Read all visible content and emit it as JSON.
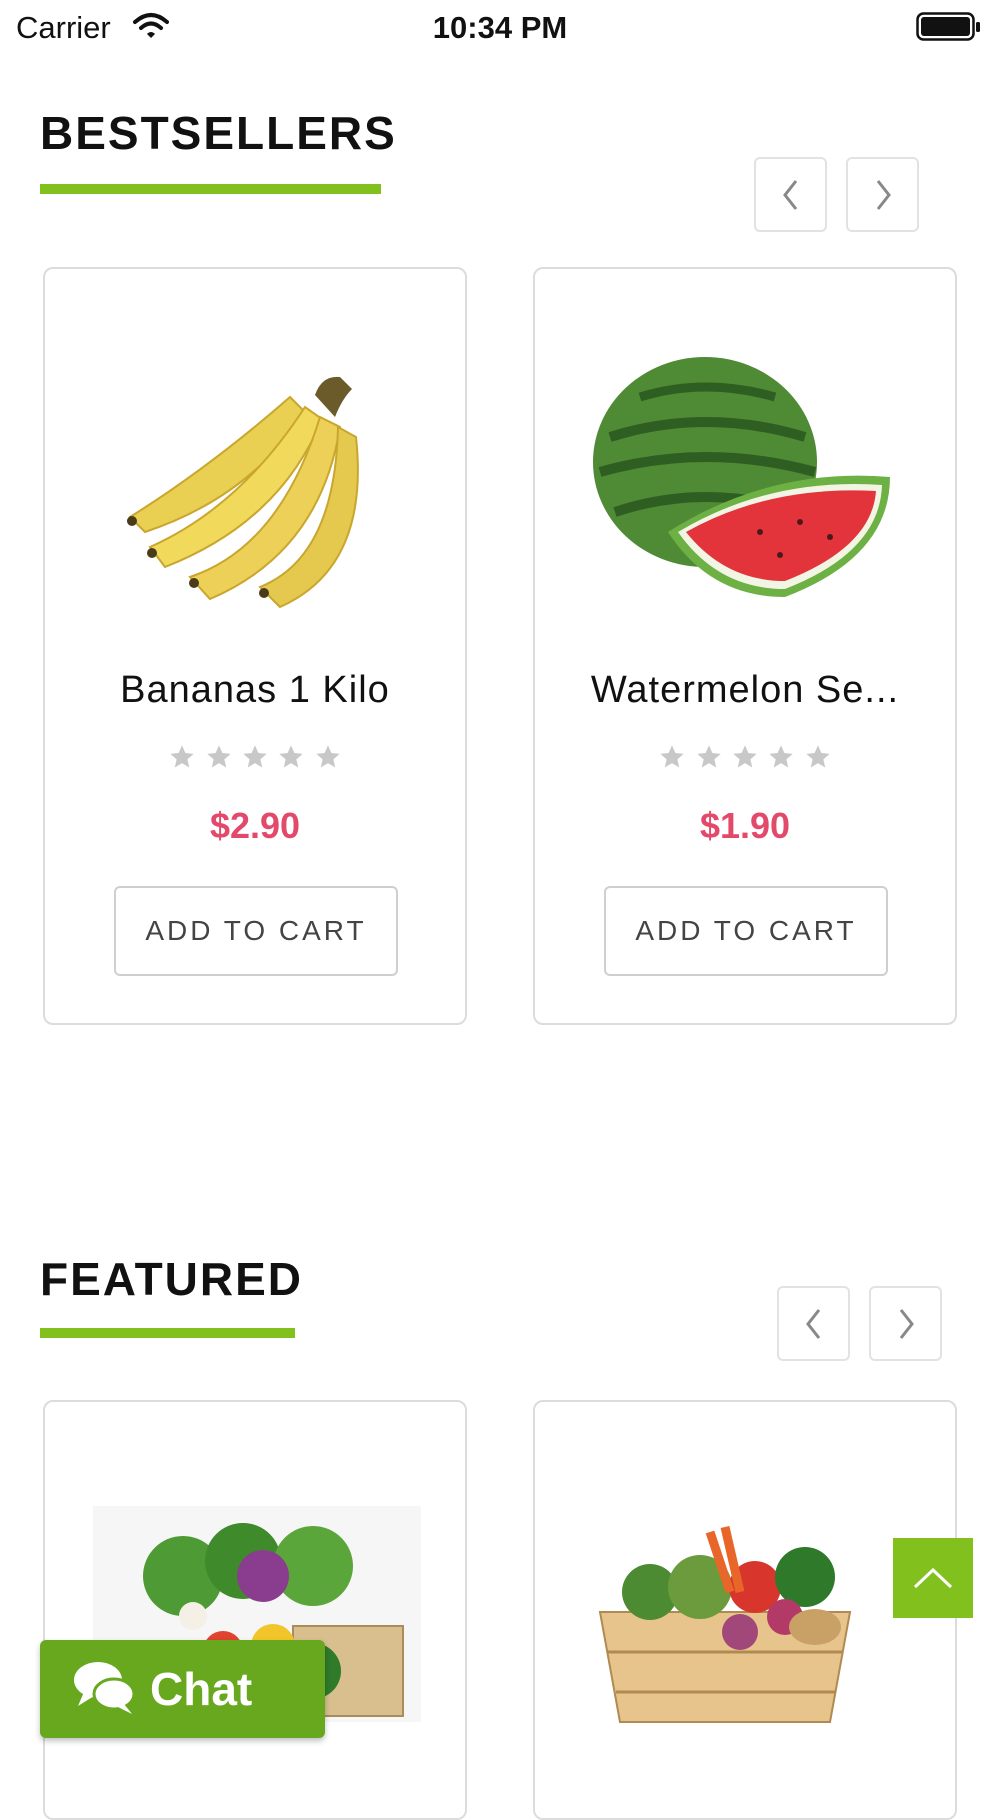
{
  "status_bar": {
    "carrier": "Carrier",
    "time": "10:34 PM"
  },
  "sections": {
    "bestsellers": {
      "title": "BESTSELLERS",
      "products": [
        {
          "name": "Bananas 1 Kilo",
          "price": "$2.90",
          "rating": 0,
          "cart_label": "ADD TO CART",
          "image": "banana-bunch"
        },
        {
          "name": "Watermelon Se...",
          "price": "$1.90",
          "rating": 0,
          "cart_label": "ADD TO CART",
          "image": "watermelon"
        }
      ]
    },
    "featured": {
      "title": "FEATURED",
      "products": [
        {
          "image": "vegetable-basket"
        },
        {
          "image": "vegetable-crate"
        }
      ]
    }
  },
  "chat": {
    "label": "Chat"
  },
  "colors": {
    "accent": "#82c01e",
    "price": "#e3496b",
    "chat": "#67a81f"
  },
  "icons": {
    "prev": "chevron-left-icon",
    "next": "chevron-right-icon",
    "scroll_top": "chevron-up-icon",
    "chat": "chat-bubbles-icon"
  }
}
